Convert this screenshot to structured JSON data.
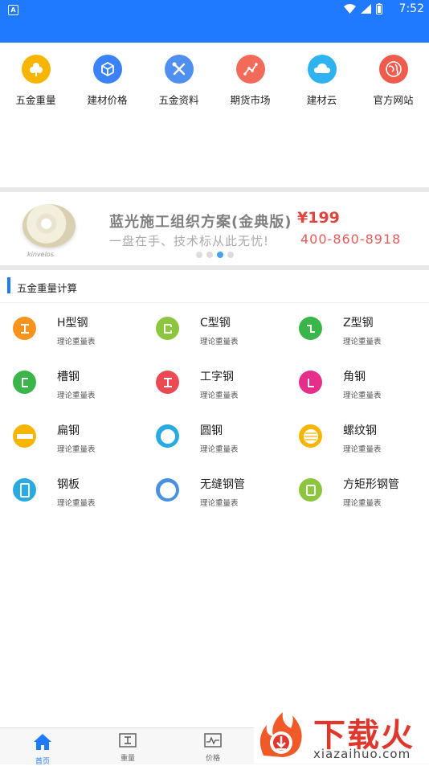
{
  "status": {
    "time": "7:52",
    "note_icon": "A"
  },
  "menu": [
    {
      "label": "五金重量",
      "icon": "clover-icon",
      "color": "#f7b500"
    },
    {
      "label": "建材价格",
      "icon": "cube-icon",
      "color": "#3b82f6"
    },
    {
      "label": "五金资料",
      "icon": "tools-icon",
      "color": "#4f8ff0"
    },
    {
      "label": "期货市场",
      "icon": "trend-icon",
      "color": "#f16a5a"
    },
    {
      "label": "建材云",
      "icon": "cloud-icon",
      "color": "#2fb2f0"
    },
    {
      "label": "官方网站",
      "icon": "globe-icon",
      "color": "#ef5b4c"
    }
  ],
  "banner": {
    "title": "蓝光施工组织方案(金典版)",
    "price": "¥199",
    "subtitle": "一盘在手、技术标从此无忧!",
    "phone": "400-860-8918",
    "disc_label": "kinvelos",
    "dots": 4,
    "active_dot": 2
  },
  "section": {
    "title": "五金重量计算"
  },
  "items": [
    {
      "name": "H型钢",
      "desc": "理论重量表",
      "icon": "h-beam-icon",
      "color": "#f7941d",
      "glyph": "工"
    },
    {
      "name": "C型钢",
      "desc": "理论重量表",
      "icon": "c-steel-icon",
      "color": "#8cc63f",
      "glyph": "C"
    },
    {
      "name": "Z型钢",
      "desc": "理论重量表",
      "icon": "z-steel-icon",
      "color": "#39b54a",
      "glyph": "Z"
    },
    {
      "name": "槽钢",
      "desc": "理论重量表",
      "icon": "channel-steel-icon",
      "color": "#39b54a",
      "glyph": "C"
    },
    {
      "name": "工字钢",
      "desc": "理论重量表",
      "icon": "i-beam-icon",
      "color": "#ec4a53",
      "glyph": "工"
    },
    {
      "name": "角钢",
      "desc": "理论重量表",
      "icon": "angle-steel-icon",
      "color": "#e62e8a",
      "glyph": "L"
    },
    {
      "name": "扁钢",
      "desc": "理论重量表",
      "icon": "flat-steel-icon",
      "color": "#f7b500",
      "glyph": ""
    },
    {
      "name": "圆钢",
      "desc": "理论重量表",
      "icon": "round-steel-icon",
      "color": "#29abe2",
      "glyph": ""
    },
    {
      "name": "螺纹钢",
      "desc": "理论重量表",
      "icon": "rebar-icon",
      "color": "#f7b500",
      "glyph": ""
    },
    {
      "name": "钢板",
      "desc": "理论重量表",
      "icon": "steel-plate-icon",
      "color": "#29abe2",
      "glyph": ""
    },
    {
      "name": "无缝钢管",
      "desc": "理论重量表",
      "icon": "seamless-pipe-icon",
      "color": "#4a90e2",
      "glyph": ""
    },
    {
      "name": "方矩形钢管",
      "desc": "理论重量表",
      "icon": "square-tube-icon",
      "color": "#8cc63f",
      "glyph": ""
    }
  ],
  "nav": [
    {
      "label": "首页",
      "icon": "home-icon",
      "active": true
    },
    {
      "label": "重量",
      "icon": "weight-icon",
      "active": false
    },
    {
      "label": "价格",
      "icon": "price-chart-icon",
      "active": false
    }
  ],
  "watermark": {
    "big": "下载火",
    "small": "xiazaihuo.com"
  }
}
